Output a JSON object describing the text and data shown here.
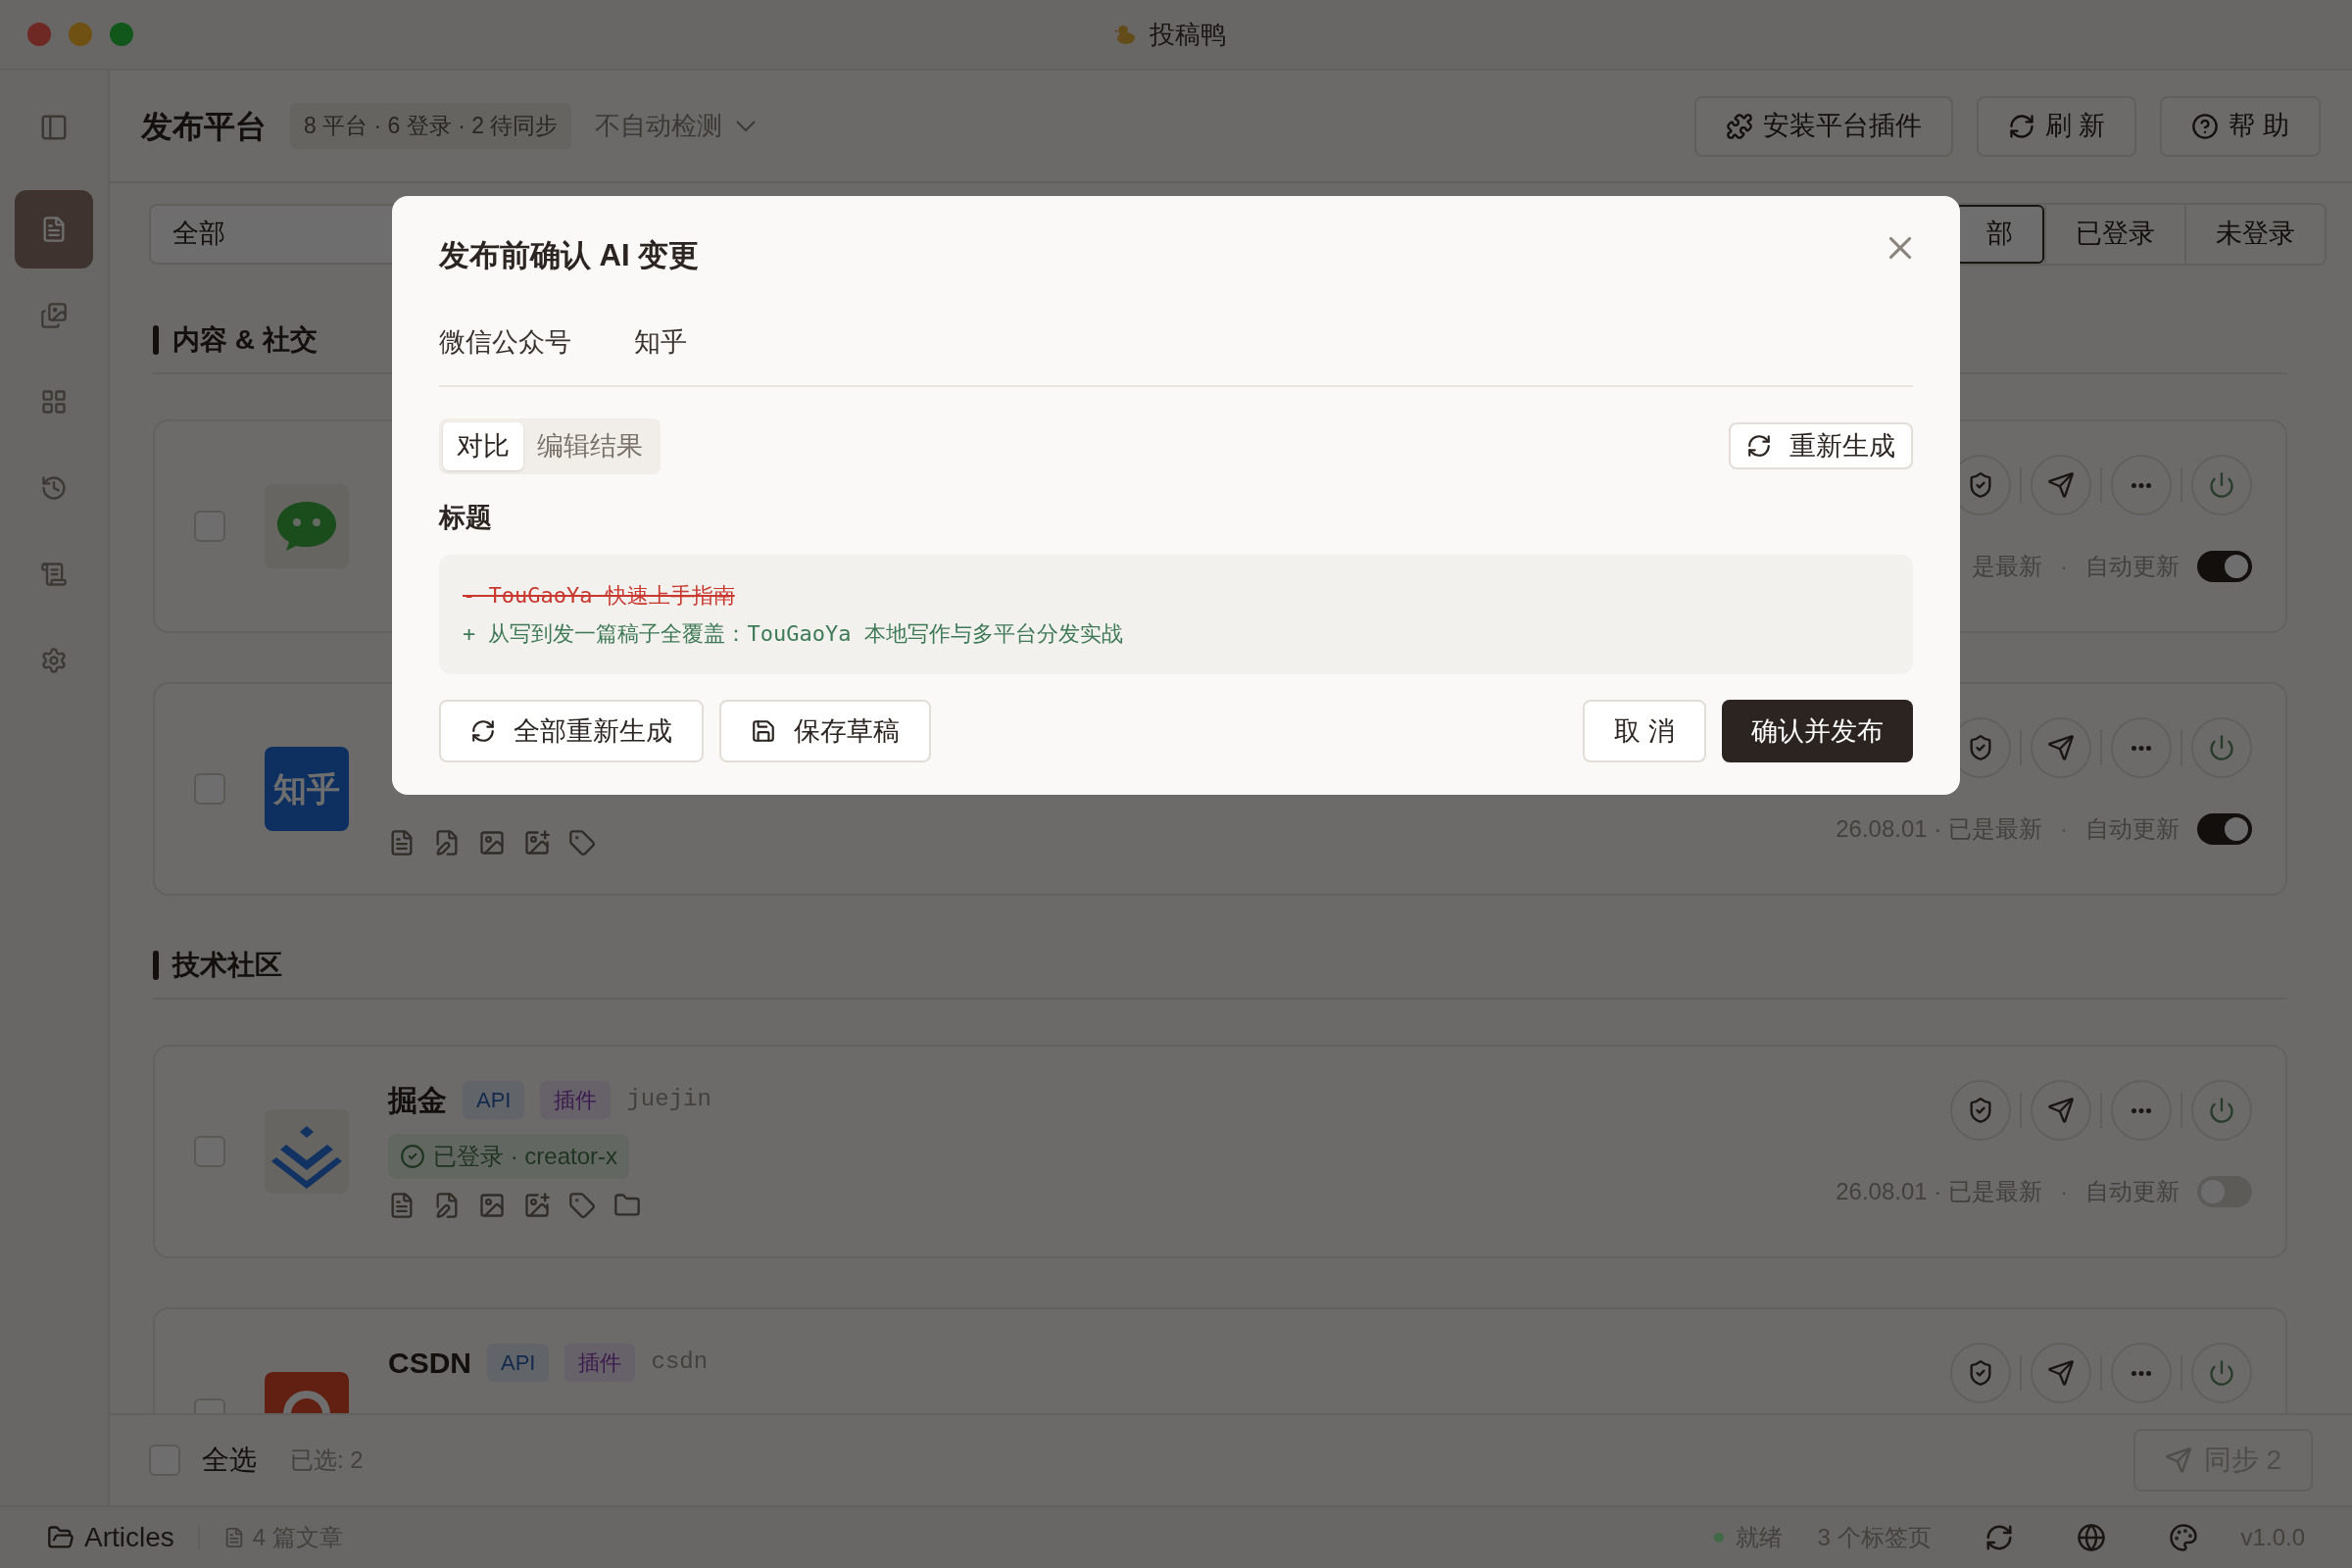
{
  "window": {
    "title": "投稿鸭"
  },
  "header": {
    "title": "发布平台",
    "summary": "8 平台 · 6 登录 · 2 待同步",
    "detect": "不自动检测",
    "buttons": [
      {
        "kind": "plugin",
        "label": "安装平台插件"
      },
      {
        "kind": "refresh",
        "label": "刷 新"
      },
      {
        "kind": "help",
        "label": "帮 助"
      }
    ]
  },
  "sidebar": {
    "items": [
      {
        "kind": "articles",
        "selected": true
      },
      {
        "kind": "gallery",
        "selected": false
      },
      {
        "kind": "grid",
        "selected": false
      },
      {
        "kind": "history",
        "selected": false
      },
      {
        "kind": "scroll",
        "selected": false
      },
      {
        "kind": "settings",
        "selected": false
      }
    ]
  },
  "filter": {
    "select": "全部",
    "tabs": [
      {
        "label": "部",
        "selected": true
      },
      {
        "label": "已登录",
        "selected": false
      },
      {
        "label": "未登录",
        "selected": false
      }
    ]
  },
  "sections": [
    {
      "title": "内容 & 社交",
      "cards": [
        {
          "kind": "wechat",
          "checked": false,
          "version": "是最新",
          "separator": "·",
          "auto_label": "自动更新",
          "auto_update": true
        },
        {
          "kind": "zhihu",
          "logo_text": "知乎",
          "checked": false,
          "features": [
            {
              "kind": "doc"
            },
            {
              "kind": "draft"
            },
            {
              "kind": "image"
            },
            {
              "kind": "image-add"
            },
            {
              "kind": "tag"
            }
          ],
          "version": "26.08.01 · 已是最新",
          "separator": "·",
          "auto_label": "自动更新",
          "auto_update": true
        }
      ]
    },
    {
      "title": "技术社区",
      "cards": [
        {
          "kind": "juejin",
          "checked": false,
          "name": "掘金",
          "tags": [
            {
              "label": "API",
              "kind": "api"
            },
            {
              "label": "插件",
              "kind": "plugin"
            }
          ],
          "slug": "juejin",
          "status": "已登录 · creator-x",
          "features": [
            {
              "kind": "doc"
            },
            {
              "kind": "draft"
            },
            {
              "kind": "image"
            },
            {
              "kind": "image-add"
            },
            {
              "kind": "tag"
            },
            {
              "kind": "folder"
            }
          ],
          "version": "26.08.01 · 已是最新",
          "separator": "·",
          "auto_label": "自动更新",
          "auto_update": false
        },
        {
          "kind": "csdn",
          "checked": false,
          "name": "CSDN",
          "tags": [
            {
              "label": "API",
              "kind": "api"
            },
            {
              "label": "插件",
              "kind": "plugin"
            }
          ],
          "slug": "csdn"
        }
      ]
    }
  ],
  "footer": {
    "select_all": {
      "label": "全选",
      "checked": false
    },
    "selected_count": "已选: 2",
    "sync": {
      "label": "同步 2",
      "disabled": true
    }
  },
  "status_bar": {
    "folder": "Articles",
    "articles": "4 篇文章",
    "state": {
      "label": "就绪",
      "color": "#3f6a45"
    },
    "tabs": "3 个标签页",
    "version": "v1.0.0"
  },
  "dialog": {
    "title": "发布前确认 AI 变更",
    "platforms": [
      "微信公众号",
      "知乎"
    ],
    "views": [
      {
        "label": "对比",
        "selected": true
      },
      {
        "label": "编辑结果",
        "selected": false
      }
    ],
    "regenerate": "重新生成",
    "field_label": "标题",
    "diff": [
      {
        "kind": "removed",
        "text": "- TouGaoYa 快速上手指南"
      },
      {
        "kind": "added",
        "text": "+ 从写到发一篇稿子全覆盖：TouGaoYa 本地写作与多平台分发实战"
      }
    ],
    "buttons": [
      {
        "kind": "regen-all",
        "label": "全部重新生成"
      },
      {
        "kind": "save",
        "label": "保存草稿"
      },
      {
        "kind": "cancel",
        "label": "取 消"
      },
      {
        "kind": "confirm",
        "label": "确认并发布"
      }
    ]
  }
}
